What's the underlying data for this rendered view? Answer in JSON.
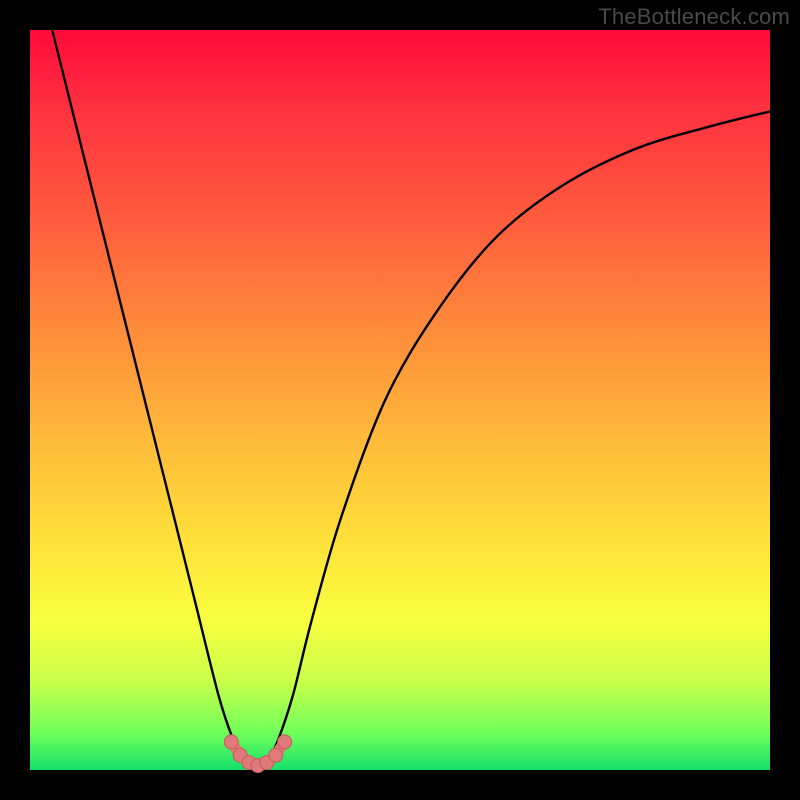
{
  "watermark": "TheBottleneck.com",
  "colors": {
    "gradient_top": "#ff0a3a",
    "gradient_mid1": "#ff8a3a",
    "gradient_mid2": "#ffe33a",
    "gradient_bottom": "#14e06a",
    "curve": "#000000",
    "marker_fill": "#e07a7a",
    "marker_stroke": "#c85a5a",
    "frame": "#000000"
  },
  "chart_data": {
    "type": "line",
    "title": "",
    "xlabel": "",
    "ylabel": "",
    "xlim": [
      0,
      100
    ],
    "ylim": [
      0,
      100
    ],
    "series": [
      {
        "name": "bottleneck-curve",
        "x": [
          3,
          6,
          10,
          14,
          18,
          22,
          25.5,
          27.5,
          29,
          30.5,
          32,
          33.5,
          35.5,
          38,
          42,
          48,
          55,
          63,
          72,
          82,
          92,
          100
        ],
        "y": [
          100,
          88,
          72,
          56,
          40,
          24,
          10,
          4,
          1,
          0.5,
          1,
          4,
          10,
          20,
          34,
          50,
          62,
          72,
          79,
          84,
          87,
          89
        ]
      }
    ],
    "markers": {
      "name": "valley-markers",
      "x": [
        27.2,
        28.4,
        29.6,
        30.8,
        32.0,
        33.2,
        34.4
      ],
      "y": [
        3.8,
        2.0,
        1.0,
        0.6,
        1.0,
        2.0,
        3.8
      ]
    }
  }
}
